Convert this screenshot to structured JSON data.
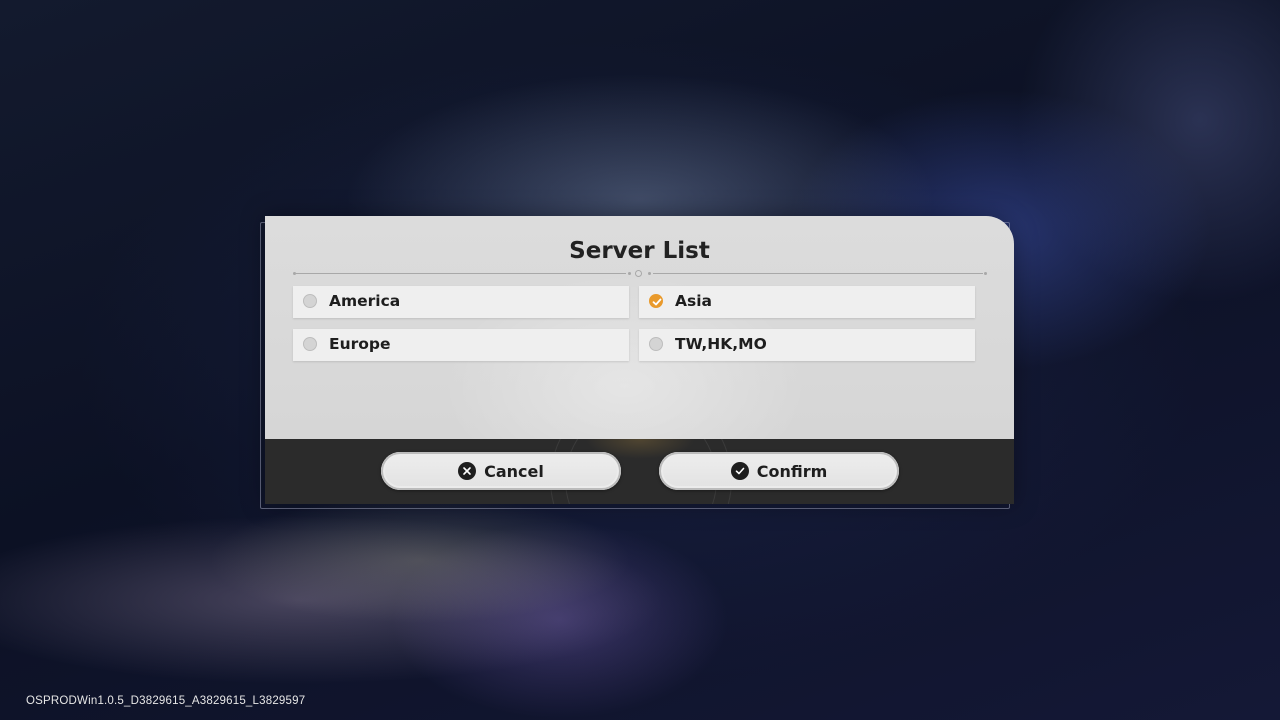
{
  "dialog": {
    "title": "Server List",
    "servers": [
      {
        "label": "America",
        "selected": false
      },
      {
        "label": "Asia",
        "selected": true
      },
      {
        "label": "Europe",
        "selected": false
      },
      {
        "label": "TW,HK,MO",
        "selected": false
      }
    ],
    "cancel_label": "Cancel",
    "confirm_label": "Confirm"
  },
  "footer": {
    "version": "OSPRODWin1.0.5_D3829615_A3829615_L3829597"
  },
  "colors": {
    "selected_accent": "#e99a2c",
    "panel_light": "#dcdcdc",
    "panel_dark": "#2b2b2b"
  },
  "icons": {
    "cancel": "close-icon",
    "confirm": "check-icon",
    "selected": "checkmark-radio-icon"
  }
}
